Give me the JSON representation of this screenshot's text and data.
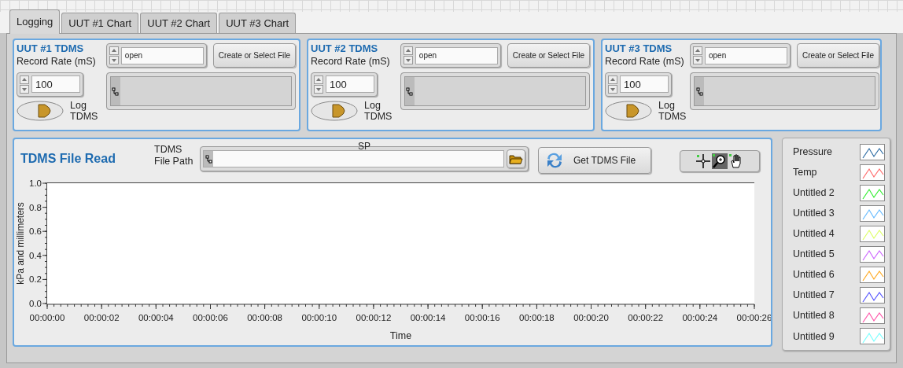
{
  "tabs": [
    {
      "label": "Logging",
      "selected": true
    },
    {
      "label": "UUT #1 Chart",
      "selected": false
    },
    {
      "label": "UUT #2 Chart",
      "selected": false
    },
    {
      "label": "UUT #3 Chart",
      "selected": false
    }
  ],
  "uut_panels": [
    {
      "title": "UUT #1 TDMS",
      "rate_label": "Record Rate (mS)",
      "rate_value": "100",
      "mode": "open",
      "button": "Create or Select File",
      "log_label": "Log TDMS",
      "log_on": false
    },
    {
      "title": "UUT #2 TDMS",
      "rate_label": "Record Rate (mS)",
      "rate_value": "100",
      "mode": "open",
      "button": "Create or Select File",
      "log_label": "Log TDMS",
      "log_on": false
    },
    {
      "title": "UUT #3 TDMS",
      "rate_label": "Record Rate (mS)",
      "rate_value": "100",
      "mode": "open",
      "button": "Create or Select File",
      "log_label": "Log TDMS",
      "log_on": false
    }
  ],
  "file_read": {
    "title": "TDMS File Read",
    "path_label": "TDMS File Path",
    "path_caption": "SP",
    "button": "Get TDMS File",
    "tools": [
      {
        "kind": "cursor",
        "selected": false
      },
      {
        "kind": "zoom",
        "selected": true
      },
      {
        "kind": "pan",
        "selected": false
      }
    ],
    "chart_data": {
      "type": "line",
      "xlabel": "Time",
      "ylabel": "kPa and millimeters",
      "xlim": [
        0,
        26
      ],
      "ylim": [
        0,
        1
      ],
      "xticks": [
        {
          "value": 0,
          "label": "00:00:00"
        },
        {
          "value": 2,
          "label": "00:00:02"
        },
        {
          "value": 4,
          "label": "00:00:04"
        },
        {
          "value": 6,
          "label": "00:00:06"
        },
        {
          "value": 8,
          "label": "00:00:08"
        },
        {
          "value": 10,
          "label": "00:00:10"
        },
        {
          "value": 12,
          "label": "00:00:12"
        },
        {
          "value": 14,
          "label": "00:00:14"
        },
        {
          "value": 16,
          "label": "00:00:16"
        },
        {
          "value": 18,
          "label": "00:00:18"
        },
        {
          "value": 20,
          "label": "00:00:20"
        },
        {
          "value": 22,
          "label": "00:00:22"
        },
        {
          "value": 24,
          "label": "00:00:24"
        },
        {
          "value": 26,
          "label": "00:00:26"
        }
      ],
      "yticks": [
        {
          "value": 0,
          "label": "0.0"
        },
        {
          "value": 0.2,
          "label": "0.2"
        },
        {
          "value": 0.4,
          "label": "0.4"
        },
        {
          "value": 0.6,
          "label": "0.6"
        },
        {
          "value": 0.8,
          "label": "0.8"
        },
        {
          "value": 1,
          "label": "1.0"
        }
      ]
    }
  },
  "legend": [
    {
      "name": "Pressure",
      "color": "#2e6da4"
    },
    {
      "name": "Temp",
      "color": "#ff6b6b"
    },
    {
      "name": "Untitled 2",
      "color": "#33ee33"
    },
    {
      "name": "Untitled 3",
      "color": "#66bbff"
    },
    {
      "name": "Untitled 4",
      "color": "#ddff66"
    },
    {
      "name": "Untitled 5",
      "color": "#cc66ff"
    },
    {
      "name": "Untitled 6",
      "color": "#ffaa22"
    },
    {
      "name": "Untitled 7",
      "color": "#5555ff"
    },
    {
      "name": "Untitled 8",
      "color": "#ff55aa"
    },
    {
      "name": "Untitled 9",
      "color": "#77ffff"
    }
  ]
}
